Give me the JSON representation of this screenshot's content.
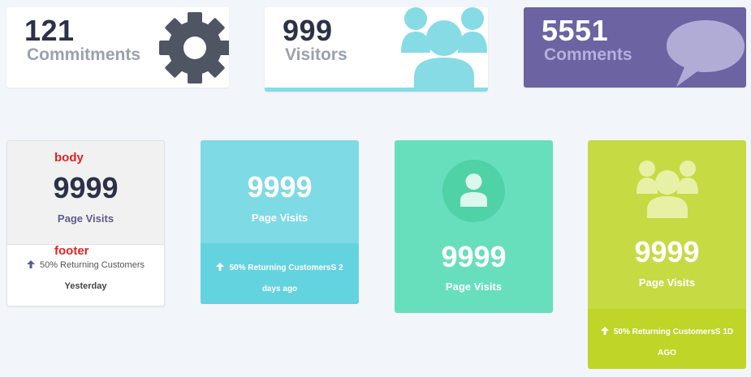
{
  "stats": [
    {
      "value": "121",
      "label": "Commitments",
      "icon": "gear-icon"
    },
    {
      "value": "999",
      "label": "Visitors",
      "icon": "users-icon"
    },
    {
      "value": "5551",
      "label": "Comments",
      "icon": "speech-bubble-icon"
    }
  ],
  "cards": {
    "card1": {
      "body_tag": "body",
      "footer_tag": "footer",
      "value": "9999",
      "label": "Page Visits",
      "footer_line1": "50% Returning Customers",
      "footer_line2": "Yesterday"
    },
    "card2": {
      "value": "9999",
      "label": "Page Visits",
      "footer": "50% Returning CustomersS 2 days ago"
    },
    "card3": {
      "value": "9999",
      "label": "Page Visits",
      "icon": "user-icon"
    },
    "card4": {
      "value": "9999",
      "label": "Page Visits",
      "icon": "users-icon",
      "footer": "50% Returning CustomersS 1D AGO"
    }
  },
  "colors": {
    "page_bg": "#f2f5f9",
    "dark_text": "#2c3147",
    "purple": "#6b63a2",
    "cyan": "#7edae5",
    "mint": "#67dfbd",
    "lime": "#c6da44",
    "red_tag": "#e02222"
  }
}
